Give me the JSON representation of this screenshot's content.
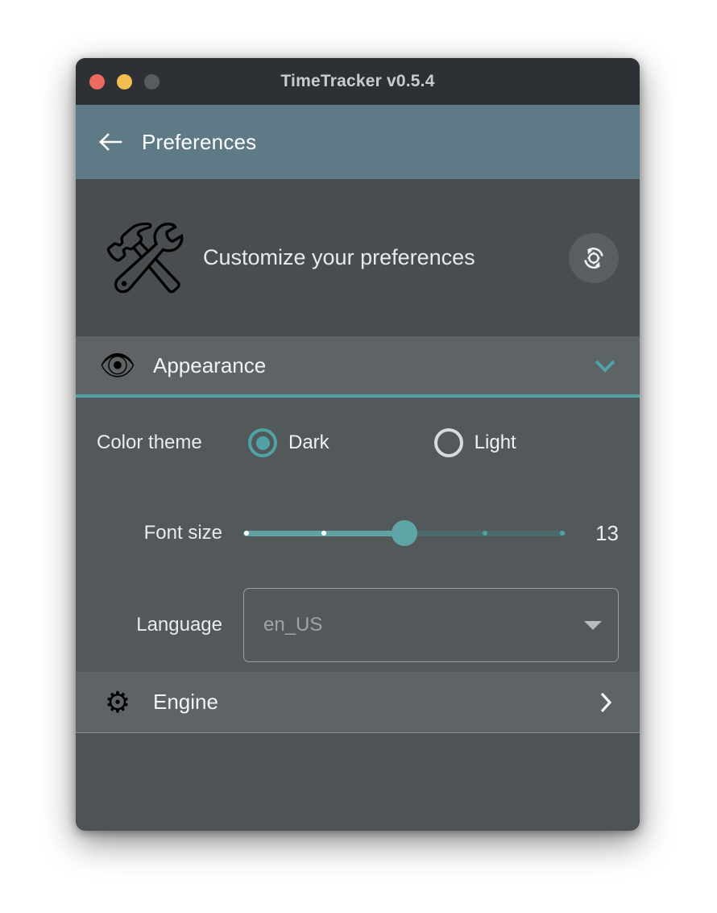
{
  "window": {
    "title": "TimeTracker v0.5.4",
    "traffic_lights": [
      {
        "name": "close",
        "color": "#ec6a5e"
      },
      {
        "name": "minimize",
        "color": "#f4bd4f"
      },
      {
        "name": "zoom",
        "color": "#585c60"
      }
    ]
  },
  "app_bar": {
    "back_icon": "arrow-left-icon",
    "title": "Preferences",
    "background": "#5f7a87"
  },
  "hero": {
    "icon": "🛠",
    "icon_name": "wrench-and-gear-icon",
    "text": "Customize your preferences",
    "reset_icon_name": "restore-settings-icon"
  },
  "sections": [
    {
      "id": "appearance",
      "title": "Appearance",
      "icon": "👁",
      "icon_name": "appearance-eye-gear-icon",
      "expanded": true,
      "chevron": "chevron-down-icon",
      "accent": "#4fa3a5"
    },
    {
      "id": "engine",
      "title": "Engine",
      "icon": "⚙",
      "icon_name": "gears-icon",
      "expanded": false,
      "chevron": "chevron-right-icon"
    }
  ],
  "appearance": {
    "color_theme": {
      "label": "Color theme",
      "selected": "Dark",
      "options": [
        {
          "label": "Dark",
          "selected": true
        },
        {
          "label": "Light",
          "selected": false
        }
      ]
    },
    "font_size": {
      "label": "Font size",
      "value": "13",
      "percent": 50,
      "ticks": [
        0,
        25,
        50,
        75,
        100
      ]
    },
    "language": {
      "label": "Language",
      "value": "en_US",
      "placeholder": "en_US",
      "caret": "dropdown-caret-icon"
    }
  },
  "theme": {
    "accent": "#4fa3a5",
    "title_bar": "#2d3034",
    "body": "#4e5356",
    "hero": "#494d50",
    "section_header": "#5e6366",
    "section_body": "#53585b"
  }
}
